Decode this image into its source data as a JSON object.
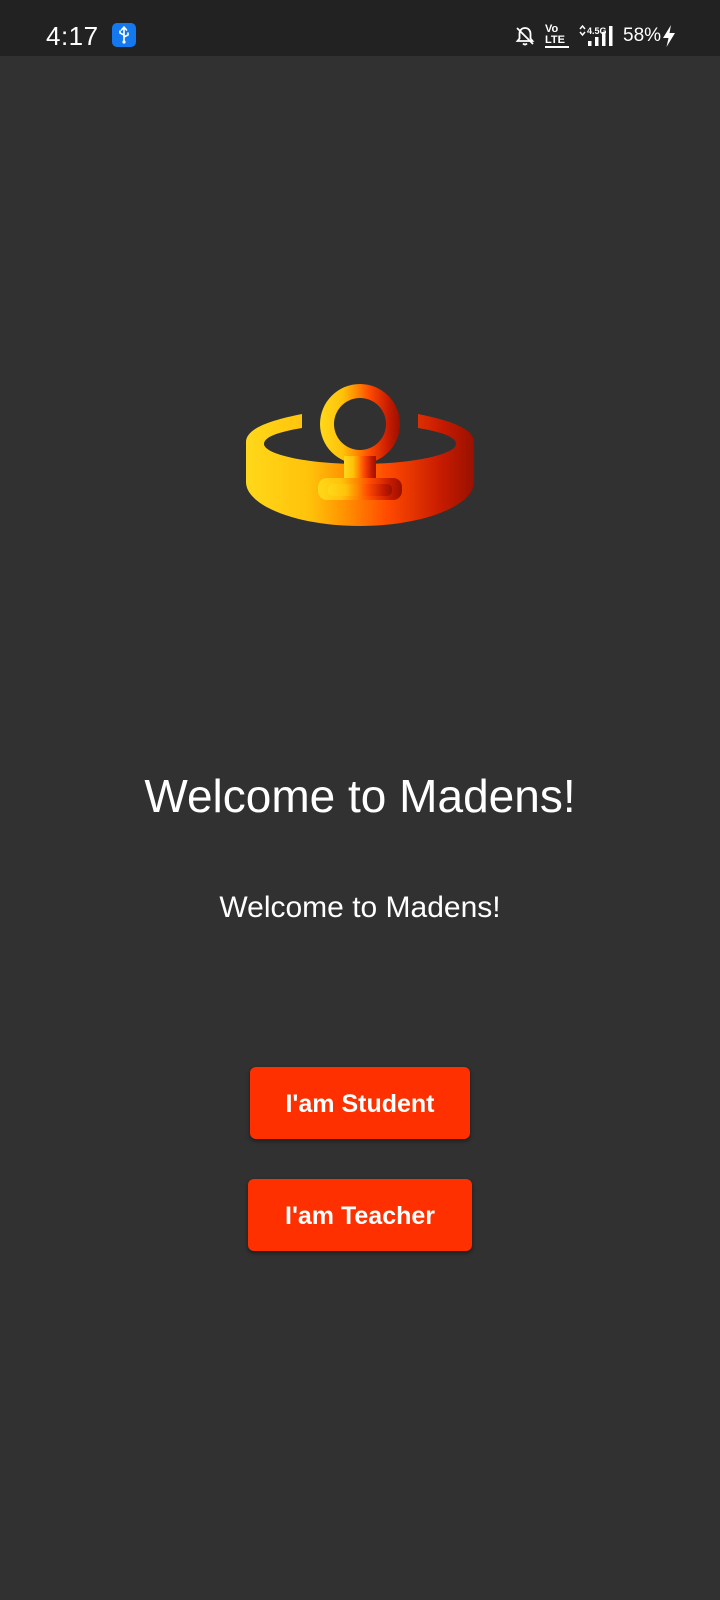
{
  "status_bar": {
    "time": "4:17",
    "battery": "58%",
    "network_label": "4.5G",
    "volte_top": "Vo",
    "volte_bottom": "LTE",
    "icons": [
      "usb-icon",
      "bell-off-icon",
      "volte-icon",
      "signal-icon",
      "charging-icon"
    ],
    "usb_badge_color": "#1479ee"
  },
  "welcome": {
    "title": "Welcome to Madens!",
    "subtitle": "Welcome to Madens!"
  },
  "buttons": {
    "student_label": "I'am Student",
    "teacher_label": "I'am Teacher"
  },
  "colors": {
    "background": "#313131",
    "status_bar": "#222222",
    "button": "#ff3000",
    "logo_gradient": [
      "#ffd21a",
      "#ff8a00",
      "#ff4a00",
      "#a81200"
    ]
  },
  "logo": {
    "icon": "madens-logo-icon"
  }
}
